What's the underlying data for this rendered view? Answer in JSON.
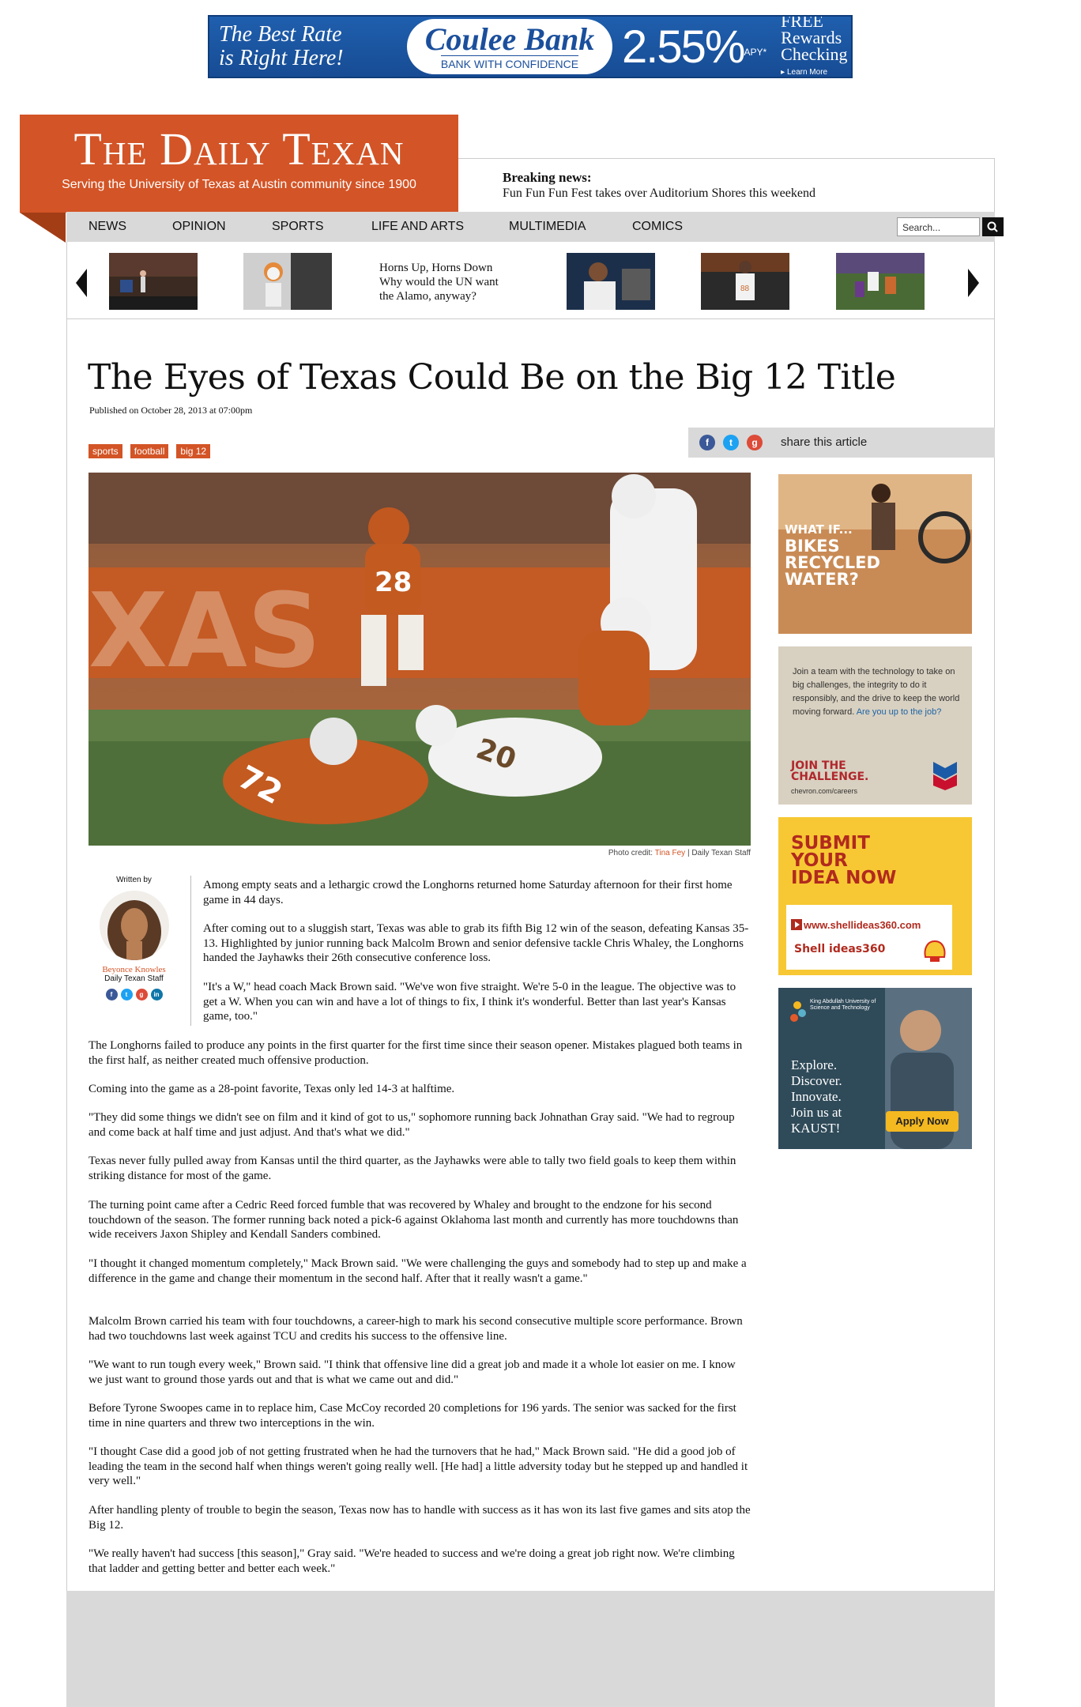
{
  "top_ad": {
    "rate_line1": "The Best Rate",
    "rate_line2": "is Right Here!",
    "bank_name": "Coulee Bank",
    "bank_tagline": "BANK WITH CONFIDENCE",
    "rate": "2.55%",
    "apy": "APY*",
    "free_line1": "FREE",
    "free_line2": "Rewards",
    "free_line3": "Checking",
    "learn_more": "▸ Learn More"
  },
  "logo": {
    "title": "The Daily Texan",
    "tagline": "Serving the University of Texas at Austin community since 1900"
  },
  "breaking": {
    "label": "Breaking news:",
    "text": "Fun Fun Fun Fest takes over Auditorium Shores this weekend"
  },
  "nav": {
    "items": [
      "NEWS",
      "OPINION",
      "SPORTS",
      "LIFE AND ARTS",
      "MULTIMEDIA",
      "COMICS"
    ],
    "search_placeholder": "Search..."
  },
  "carousel": {
    "text_line1": "Horns Up, Horns Down",
    "text_line2": "Why would the UN want",
    "text_line3": "the Alamo, anyway?"
  },
  "article": {
    "headline": "The Eyes of Texas Could Be on the Big 12 Title",
    "published": "Published on October 28, 2013 at 07:00pm",
    "tags": [
      "sports",
      "football",
      "big 12"
    ],
    "share_label": "share this article",
    "photo_credit_prefix": "Photo credit: ",
    "photo_credit_name": "Tina Fey",
    "photo_credit_suffix": " | Daily Texan Staff",
    "author_written_by": "Written by",
    "author_name": "Beyonce Knowles",
    "author_staff": "Daily Texan Staff",
    "paragraphs": [
      "Among empty seats and a lethargic crowd the Longhorns returned home Saturday afternoon for their first home game in 44 days.",
      "After coming out to a sluggish start, Texas was able to grab its fifth Big 12 win of the season, defeating Kansas 35-13. Highlighted by junior running back Malcolm Brown and senior defensive tackle Chris Whaley, the Longhorns handed the Jayhawks their 26th consecutive conference loss.",
      "\"It's a W,\" head coach Mack Brown said. \"We've won five straight. We're 5-0 in the league. The objective was to get a W. When you can win and have a lot of things to fix, I think it's wonderful. Better than last year's Kansas game, too.\"",
      "The Longhorns failed to produce any points in the first quarter for the first time since their season opener. Mistakes plagued both teams in the first half, as neither created much offensive production.",
      "Coming into the game as a 28-point favorite, Texas only led 14-3 at halftime.",
      "\"They did some things we didn't see on film and it kind of got to us,\" sophomore running back Johnathan Gray said. \"We had to regroup and come back at half time and just adjust. And that's what we did.\"",
      "Texas never fully pulled away from Kansas until the third quarter, as the Jayhawks were able to tally two field goals to keep them within striking distance for most of the game.",
      "The turning point came after a Cedric Reed forced fumble that was recovered by Whaley and brought to the endzone for his second touchdown of the season. The former running back noted a pick-6 against Oklahoma last month and currently has more touchdowns than wide receivers Jaxon Shipley and Kendall Sanders combined.",
      "\"I thought it changed momentum completely,\" Mack Brown said. \"We were challenging the guys and somebody had to step up and make a difference in the game and change their momentum in the second half. After that it really wasn't a game.\"",
      "Malcolm Brown carried his team with four touchdowns, a career-high to mark his second consecutive multiple score performance. Brown had two touchdowns last week against TCU and credits his success to the offensive line.",
      "\"We want to run tough every week,\" Brown said. \"I think that offensive line did a great job and made it a whole lot easier on me. I know we just want to ground those yards out and that is what we came out and did.\"",
      "Before Tyrone Swoopes came in to replace him, Case McCoy recorded 20 completions for 196 yards. The senior was sacked for the first time in nine quarters and threw two interceptions in the win.",
      "\"I thought Case did a good job of not getting frustrated when he had the turnovers that he had,\" Mack Brown said. \"He did a good job of leading the team in the second half when things weren't going really well. [He had] a little adversity today but he stepped up and handled it very well.\"",
      "After handling plenty of trouble to begin the season, Texas now has to handle with success as it has won its last five games and sits atop the Big 12.",
      "\"We really haven't had success [this season],\" Gray said. \"We're headed to success and we're doing a great job right now. We're climbing that ladder and getting better and better each week.\""
    ]
  },
  "sidebar_ads": {
    "ad1_line1": "WHAT IF...",
    "ad1_line2": "BIKES",
    "ad1_line3": "RECYCLED",
    "ad1_line4": "WATER?",
    "ad2_text": "Join a team with the technology to take on big challenges, the integrity to do it responsibly, and the drive to keep the world moving forward.",
    "ad2_question": "Are you up to the job?",
    "ad2_join_line1": "JOIN THE",
    "ad2_join_line2": "CHALLENGE.",
    "ad2_url": "chevron.com/careers",
    "ad3_line1": "SUBMIT",
    "ad3_line2": "YOUR",
    "ad3_line3": "IDEA NOW",
    "ad3_url": "www.shellideas360.com",
    "ad3_brand": "Shell ideas360",
    "ad4_org": "King Abdullah University of Science and Technology",
    "ad4_line1": "Explore.",
    "ad4_line2": "Discover.",
    "ad4_line3": "Innovate.",
    "ad4_line4": "Join us at",
    "ad4_line5": "KAUST!",
    "ad4_button": "Apply Now"
  },
  "colors": {
    "brand_orange": "#d35426",
    "nav_gray": "#d9d9d9"
  }
}
